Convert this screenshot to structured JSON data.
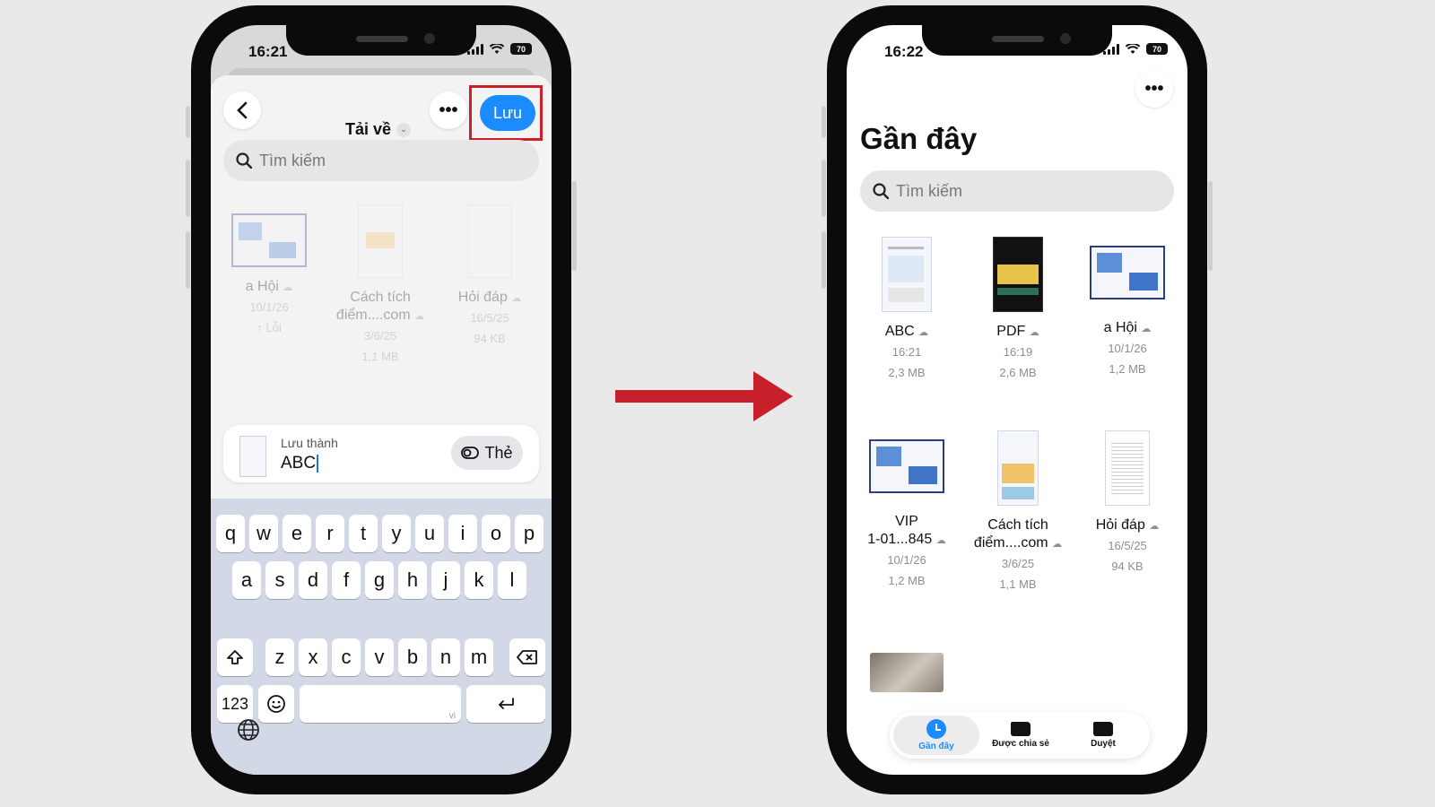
{
  "left_phone": {
    "time": "16:21",
    "battery": "70",
    "header": {
      "location_title": "Tải về",
      "save_label": "Lưu"
    },
    "search_placeholder": "Tìm kiếm",
    "files": [
      {
        "name": "a Hội",
        "date": "10/1/26",
        "extra": "↑ Lỗi"
      },
      {
        "name": "Cách tích",
        "name2": "điểm....com",
        "date": "3/6/25",
        "size": "1,1 MB"
      },
      {
        "name": "Hỏi đáp",
        "date": "16/5/25",
        "size": "94 KB"
      }
    ],
    "save_as": {
      "label": "Lưu thành",
      "value": "ABC",
      "tag_label": "Thẻ"
    },
    "keyboard": {
      "row1": [
        "q",
        "w",
        "e",
        "r",
        "t",
        "y",
        "u",
        "i",
        "o",
        "p"
      ],
      "row2": [
        "a",
        "s",
        "d",
        "f",
        "g",
        "h",
        "j",
        "k",
        "l"
      ],
      "row3": [
        "z",
        "x",
        "c",
        "v",
        "b",
        "n",
        "m"
      ],
      "numbers_key": "123",
      "space_hint": "vi"
    }
  },
  "right_phone": {
    "time": "16:22",
    "battery": "70",
    "title": "Gần đây",
    "search_placeholder": "Tìm kiếm",
    "files": [
      {
        "name": "ABC",
        "date": "16:21",
        "size": "2,3 MB"
      },
      {
        "name": "PDF",
        "date": "16:19",
        "size": "2,6 MB"
      },
      {
        "name": "a Hội",
        "date": "10/1/26",
        "size": "1,2 MB"
      },
      {
        "name": "VIP",
        "name2": "1-01...845",
        "date": "10/1/26",
        "size": "1,2 MB"
      },
      {
        "name": "Cách tích",
        "name2": "điểm....com",
        "date": "3/6/25",
        "size": "1,1 MB"
      },
      {
        "name": "Hỏi đáp",
        "date": "16/5/25",
        "size": "94 KB"
      }
    ],
    "tabs": [
      "Gần đây",
      "Được chia sẻ",
      "Duyệt"
    ]
  }
}
